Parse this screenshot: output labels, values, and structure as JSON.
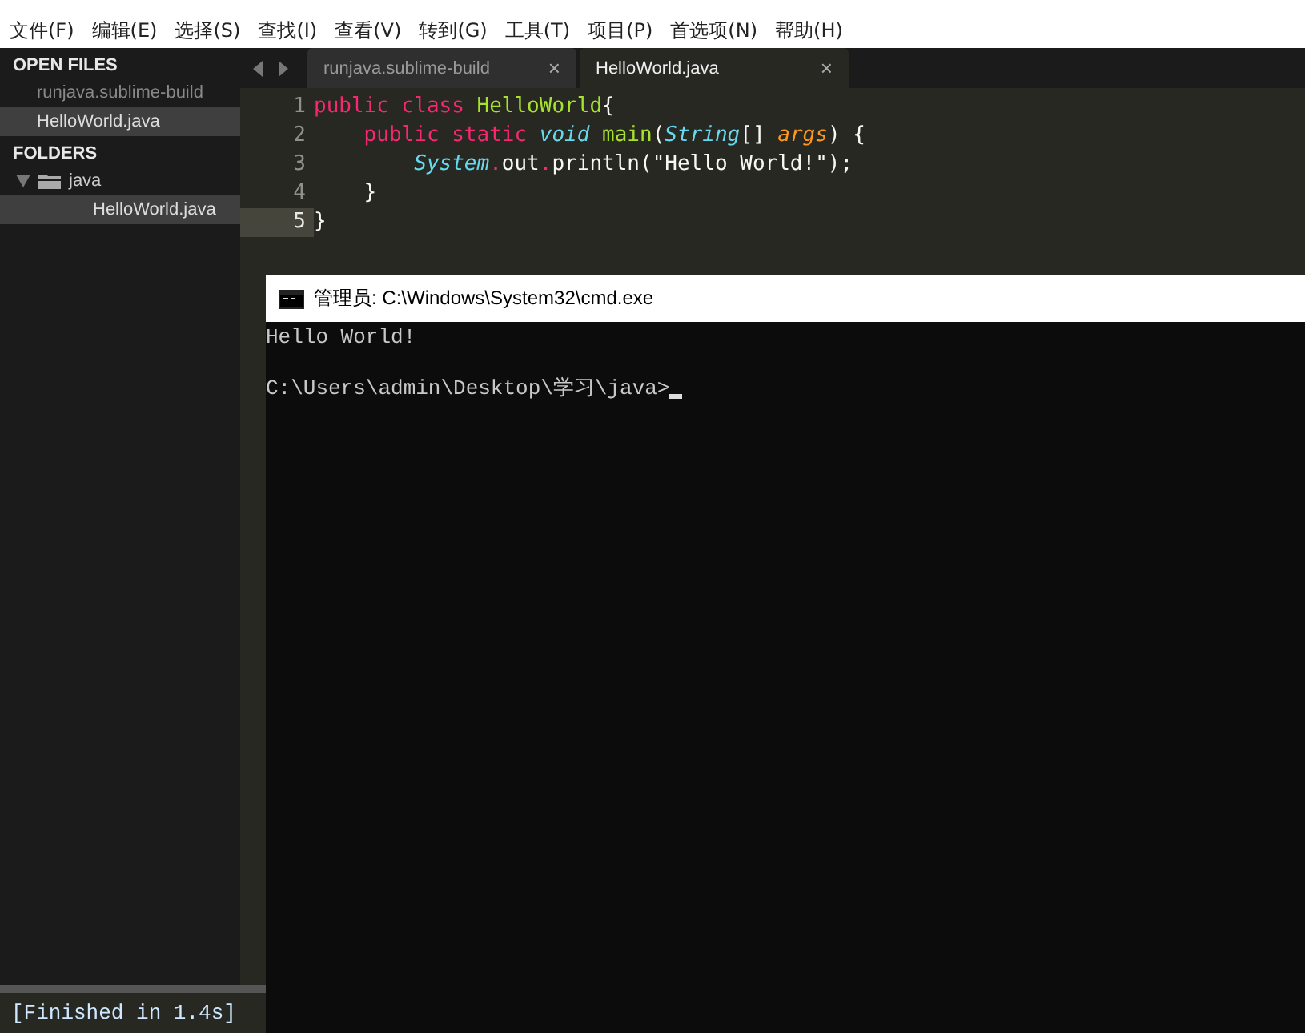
{
  "menu": [
    "文件(F)",
    "编辑(E)",
    "选择(S)",
    "查找(I)",
    "查看(V)",
    "转到(G)",
    "工具(T)",
    "项目(P)",
    "首选项(N)",
    "帮助(H)"
  ],
  "sidebar": {
    "open_files_title": "OPEN FILES",
    "open_files": [
      {
        "label": "runjava.sublime-build",
        "selected": false
      },
      {
        "label": "HelloWorld.java",
        "selected": true
      }
    ],
    "folders_title": "FOLDERS",
    "folders": [
      {
        "label": "java",
        "expanded": true,
        "children": [
          {
            "label": "HelloWorld.java",
            "selected": true
          }
        ]
      }
    ]
  },
  "tabs": [
    {
      "label": "runjava.sublime-build",
      "selected": false,
      "close": "×"
    },
    {
      "label": "HelloWorld.java",
      "selected": true,
      "close": "×"
    }
  ],
  "code": [
    {
      "number": "1",
      "current": false,
      "tokens": [
        {
          "kind": "keyword",
          "text": "public class "
        },
        {
          "kind": "name",
          "text": "HelloWorld"
        },
        {
          "kind": "plain",
          "text": "{"
        }
      ]
    },
    {
      "number": "2",
      "current": false,
      "tokens": [
        {
          "kind": "keyword",
          "text": "    public static "
        },
        {
          "kind": "type",
          "text": "void "
        },
        {
          "kind": "name",
          "text": "main"
        },
        {
          "kind": "plain",
          "text": "("
        },
        {
          "kind": "type",
          "text": "String"
        },
        {
          "kind": "plain",
          "text": "[] "
        },
        {
          "kind": "param",
          "text": "args"
        },
        {
          "kind": "plain",
          "text": ") {"
        }
      ]
    },
    {
      "number": "3",
      "current": false,
      "tokens": [
        {
          "kind": "type",
          "text": "        System"
        },
        {
          "kind": "keyword",
          "text": "."
        },
        {
          "kind": "plain",
          "text": "out"
        },
        {
          "kind": "keyword",
          "text": "."
        },
        {
          "kind": "plain",
          "text": "println(\"Hello World!\");"
        }
      ]
    },
    {
      "number": "4",
      "current": false,
      "tokens": [
        {
          "kind": "plain",
          "text": "    }"
        }
      ]
    },
    {
      "number": "5",
      "current": true,
      "tokens": [
        {
          "kind": "plain",
          "text": "}"
        }
      ]
    }
  ],
  "console": {
    "title": "管理员: C:\\Windows\\System32\\cmd.exe",
    "lines": [
      "Hello World!",
      "C:\\Users\\admin\\Desktop\\学习\\java>"
    ]
  },
  "build_output": "[Finished in 1.4s]"
}
